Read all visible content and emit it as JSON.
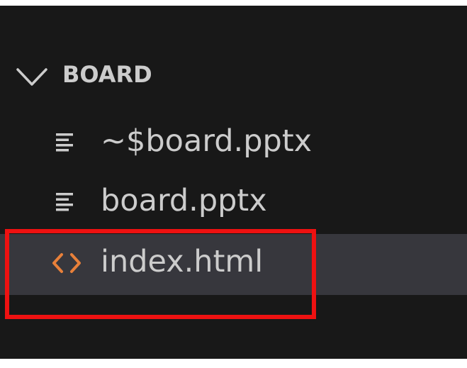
{
  "explorer": {
    "folder": {
      "name": "BOARD",
      "expanded": true,
      "icon": "chevron-down-icon"
    },
    "files": [
      {
        "name": "~$board.pptx",
        "icon": "text-file-icon"
      },
      {
        "name": "board.pptx",
        "icon": "text-file-icon"
      },
      {
        "name": "index.html",
        "icon": "html-code-icon",
        "selected": true
      }
    ]
  },
  "colors": {
    "background": "#181818",
    "text": "#cccccc",
    "selected_row": "#37373d",
    "html_icon": "#e8803a",
    "highlight_box": "#ee1111"
  }
}
